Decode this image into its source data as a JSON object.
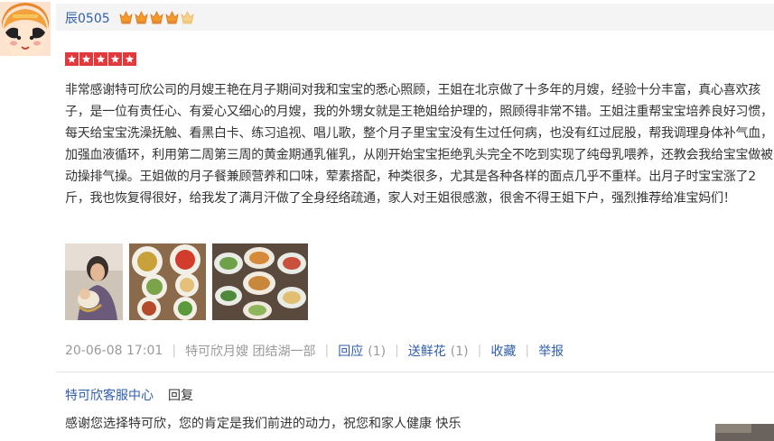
{
  "user": {
    "name": "辰0505",
    "level_crowns_filled": 4,
    "level_crowns_total": 5
  },
  "rating": {
    "stars": 5,
    "max": 5
  },
  "review": {
    "text": "非常感谢特可欣公司的月嫂王艳在月子期间对我和宝宝的悉心照顾，王姐在北京做了十多年的月嫂，经验十分丰富，真心喜欢孩子，是一位有责任心、有爱心又细心的月嫂，我的外甥女就是王艳姐给护理的，照顾得非常不错。王姐注重帮宝宝培养良好习惯，每天给宝宝洗澡抚触、看黑白卡、练习追视、唱儿歌，整个月子里宝宝没有生过任何病，也没有红过屁股，帮我调理身体补气血，加强血液循环，利用第二周第三周的黄金期通乳催乳，从刚开始宝宝拒绝乳头完全不吃到实现了纯母乳喂养，还教会我给宝宝做被动操排气操。王姐做的月子餐兼顾营养和口味，荤素搭配，种类很多，尤其是各种各样的面点几乎不重样。出月子时宝宝涨了2斤，我也恢复得很好，给我发了满月汗做了全身经络疏通，家人对王姐很感激，很舍不得王姐下户，强烈推荐给准宝妈们！"
  },
  "meta": {
    "date": "20-06-08 17:01",
    "source": "特可欣月嫂 团结湖一部",
    "reply_label": "回应",
    "reply_count": "(1)",
    "flower_label": "送鲜花",
    "flower_count": "(1)",
    "favorite_label": "收藏",
    "report_label": "举报"
  },
  "reply": {
    "author": "特可欣客服中心",
    "label": "回复",
    "text": "感谢您选择特可欣，您的肯定是我们前进的动力，祝您和家人健康 快乐"
  },
  "colors": {
    "link": "#2f5fa8",
    "star_red": "#e4393c",
    "crown_orange": "#f39a2b",
    "crown_empty": "#f6d28a",
    "header_bg": "#f4f4f4"
  }
}
